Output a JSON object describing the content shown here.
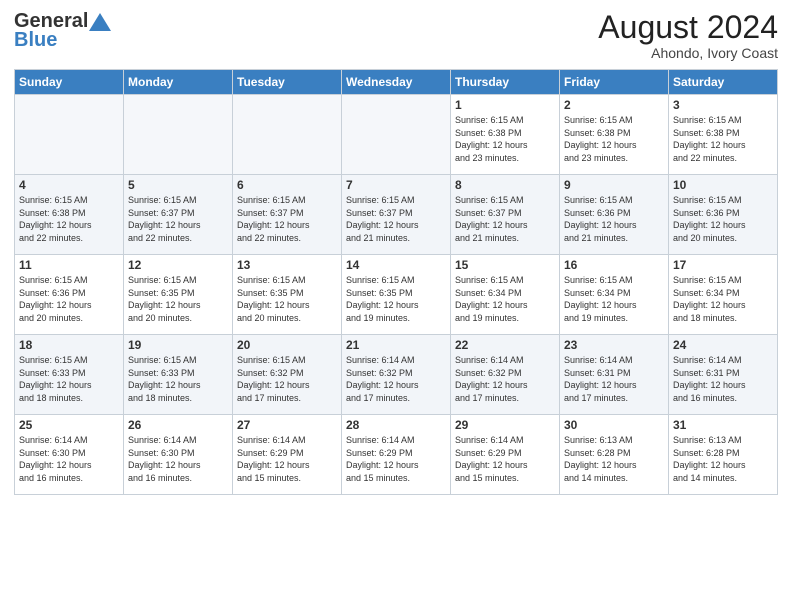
{
  "header": {
    "logo_general": "General",
    "logo_blue": "Blue",
    "month_year": "August 2024",
    "location": "Ahondo, Ivory Coast"
  },
  "days_of_week": [
    "Sunday",
    "Monday",
    "Tuesday",
    "Wednesday",
    "Thursday",
    "Friday",
    "Saturday"
  ],
  "weeks": [
    [
      {
        "day": "",
        "info": ""
      },
      {
        "day": "",
        "info": ""
      },
      {
        "day": "",
        "info": ""
      },
      {
        "day": "",
        "info": ""
      },
      {
        "day": "1",
        "info": "Sunrise: 6:15 AM\nSunset: 6:38 PM\nDaylight: 12 hours\nand 23 minutes."
      },
      {
        "day": "2",
        "info": "Sunrise: 6:15 AM\nSunset: 6:38 PM\nDaylight: 12 hours\nand 23 minutes."
      },
      {
        "day": "3",
        "info": "Sunrise: 6:15 AM\nSunset: 6:38 PM\nDaylight: 12 hours\nand 22 minutes."
      }
    ],
    [
      {
        "day": "4",
        "info": "Sunrise: 6:15 AM\nSunset: 6:38 PM\nDaylight: 12 hours\nand 22 minutes."
      },
      {
        "day": "5",
        "info": "Sunrise: 6:15 AM\nSunset: 6:37 PM\nDaylight: 12 hours\nand 22 minutes."
      },
      {
        "day": "6",
        "info": "Sunrise: 6:15 AM\nSunset: 6:37 PM\nDaylight: 12 hours\nand 22 minutes."
      },
      {
        "day": "7",
        "info": "Sunrise: 6:15 AM\nSunset: 6:37 PM\nDaylight: 12 hours\nand 21 minutes."
      },
      {
        "day": "8",
        "info": "Sunrise: 6:15 AM\nSunset: 6:37 PM\nDaylight: 12 hours\nand 21 minutes."
      },
      {
        "day": "9",
        "info": "Sunrise: 6:15 AM\nSunset: 6:36 PM\nDaylight: 12 hours\nand 21 minutes."
      },
      {
        "day": "10",
        "info": "Sunrise: 6:15 AM\nSunset: 6:36 PM\nDaylight: 12 hours\nand 20 minutes."
      }
    ],
    [
      {
        "day": "11",
        "info": "Sunrise: 6:15 AM\nSunset: 6:36 PM\nDaylight: 12 hours\nand 20 minutes."
      },
      {
        "day": "12",
        "info": "Sunrise: 6:15 AM\nSunset: 6:35 PM\nDaylight: 12 hours\nand 20 minutes."
      },
      {
        "day": "13",
        "info": "Sunrise: 6:15 AM\nSunset: 6:35 PM\nDaylight: 12 hours\nand 20 minutes."
      },
      {
        "day": "14",
        "info": "Sunrise: 6:15 AM\nSunset: 6:35 PM\nDaylight: 12 hours\nand 19 minutes."
      },
      {
        "day": "15",
        "info": "Sunrise: 6:15 AM\nSunset: 6:34 PM\nDaylight: 12 hours\nand 19 minutes."
      },
      {
        "day": "16",
        "info": "Sunrise: 6:15 AM\nSunset: 6:34 PM\nDaylight: 12 hours\nand 19 minutes."
      },
      {
        "day": "17",
        "info": "Sunrise: 6:15 AM\nSunset: 6:34 PM\nDaylight: 12 hours\nand 18 minutes."
      }
    ],
    [
      {
        "day": "18",
        "info": "Sunrise: 6:15 AM\nSunset: 6:33 PM\nDaylight: 12 hours\nand 18 minutes."
      },
      {
        "day": "19",
        "info": "Sunrise: 6:15 AM\nSunset: 6:33 PM\nDaylight: 12 hours\nand 18 minutes."
      },
      {
        "day": "20",
        "info": "Sunrise: 6:15 AM\nSunset: 6:32 PM\nDaylight: 12 hours\nand 17 minutes."
      },
      {
        "day": "21",
        "info": "Sunrise: 6:14 AM\nSunset: 6:32 PM\nDaylight: 12 hours\nand 17 minutes."
      },
      {
        "day": "22",
        "info": "Sunrise: 6:14 AM\nSunset: 6:32 PM\nDaylight: 12 hours\nand 17 minutes."
      },
      {
        "day": "23",
        "info": "Sunrise: 6:14 AM\nSunset: 6:31 PM\nDaylight: 12 hours\nand 17 minutes."
      },
      {
        "day": "24",
        "info": "Sunrise: 6:14 AM\nSunset: 6:31 PM\nDaylight: 12 hours\nand 16 minutes."
      }
    ],
    [
      {
        "day": "25",
        "info": "Sunrise: 6:14 AM\nSunset: 6:30 PM\nDaylight: 12 hours\nand 16 minutes."
      },
      {
        "day": "26",
        "info": "Sunrise: 6:14 AM\nSunset: 6:30 PM\nDaylight: 12 hours\nand 16 minutes."
      },
      {
        "day": "27",
        "info": "Sunrise: 6:14 AM\nSunset: 6:29 PM\nDaylight: 12 hours\nand 15 minutes."
      },
      {
        "day": "28",
        "info": "Sunrise: 6:14 AM\nSunset: 6:29 PM\nDaylight: 12 hours\nand 15 minutes."
      },
      {
        "day": "29",
        "info": "Sunrise: 6:14 AM\nSunset: 6:29 PM\nDaylight: 12 hours\nand 15 minutes."
      },
      {
        "day": "30",
        "info": "Sunrise: 6:13 AM\nSunset: 6:28 PM\nDaylight: 12 hours\nand 14 minutes."
      },
      {
        "day": "31",
        "info": "Sunrise: 6:13 AM\nSunset: 6:28 PM\nDaylight: 12 hours\nand 14 minutes."
      }
    ]
  ]
}
